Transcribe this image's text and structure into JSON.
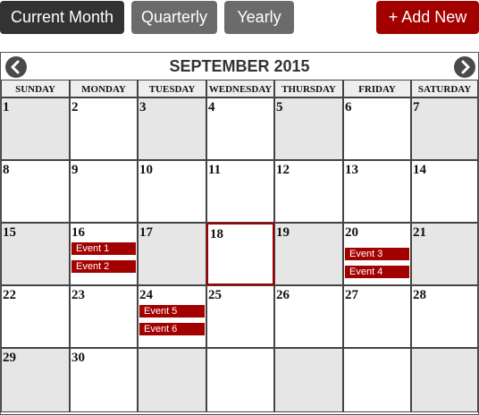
{
  "toolbar": {
    "current_month_label": "Current Month",
    "quarterly_label": "Quarterly",
    "yearly_label": "Yearly",
    "add_new_label": "+ Add New"
  },
  "calendar": {
    "title": "SEPTEMBER 2015",
    "weekdays": [
      "SUNDAY",
      "MONDAY",
      "TUESDAY",
      "WEDNESDAY",
      "THURSDAY",
      "FRIDAY",
      "SATURDAY"
    ],
    "weeks": [
      [
        {
          "day": "1",
          "shaded": true,
          "events": []
        },
        {
          "day": "2",
          "shaded": false,
          "events": []
        },
        {
          "day": "3",
          "shaded": true,
          "events": []
        },
        {
          "day": "4",
          "shaded": false,
          "events": []
        },
        {
          "day": "5",
          "shaded": true,
          "events": []
        },
        {
          "day": "6",
          "shaded": false,
          "events": []
        },
        {
          "day": "7",
          "shaded": true,
          "events": []
        }
      ],
      [
        {
          "day": "8",
          "shaded": false,
          "events": []
        },
        {
          "day": "9",
          "shaded": false,
          "events": []
        },
        {
          "day": "10",
          "shaded": false,
          "events": []
        },
        {
          "day": "11",
          "shaded": false,
          "events": []
        },
        {
          "day": "12",
          "shaded": false,
          "events": []
        },
        {
          "day": "13",
          "shaded": false,
          "events": []
        },
        {
          "day": "14",
          "shaded": false,
          "events": []
        }
      ],
      [
        {
          "day": "15",
          "shaded": true,
          "events": []
        },
        {
          "day": "16",
          "shaded": false,
          "events": [
            "Event 1",
            "Event 2"
          ]
        },
        {
          "day": "17",
          "shaded": true,
          "events": []
        },
        {
          "day": "18",
          "shaded": false,
          "today": true,
          "events": []
        },
        {
          "day": "19",
          "shaded": true,
          "events": []
        },
        {
          "day": "20",
          "shaded": false,
          "events": [
            "Event 3",
            "Event 4"
          ]
        },
        {
          "day": "21",
          "shaded": true,
          "events": []
        }
      ],
      [
        {
          "day": "22",
          "shaded": false,
          "events": []
        },
        {
          "day": "23",
          "shaded": false,
          "events": []
        },
        {
          "day": "24",
          "shaded": false,
          "events": [
            "Event 5",
            "Event 6"
          ]
        },
        {
          "day": "25",
          "shaded": false,
          "events": []
        },
        {
          "day": "26",
          "shaded": false,
          "events": []
        },
        {
          "day": "27",
          "shaded": false,
          "events": []
        },
        {
          "day": "28",
          "shaded": false,
          "events": []
        }
      ],
      [
        {
          "day": "29",
          "shaded": true,
          "events": []
        },
        {
          "day": "30",
          "shaded": false,
          "events": []
        },
        {
          "day": "",
          "shaded": true,
          "events": []
        },
        {
          "day": "",
          "shaded": false,
          "events": []
        },
        {
          "day": "",
          "shaded": true,
          "events": []
        },
        {
          "day": "",
          "shaded": false,
          "events": []
        },
        {
          "day": "",
          "shaded": true,
          "events": []
        }
      ]
    ]
  },
  "colors": {
    "accent": "#a30000",
    "dark_button": "#333333",
    "grey_button": "#6b6b6b",
    "shaded_cell": "#e6e6e6"
  },
  "icons": {
    "prev": "chevron-left-icon",
    "next": "chevron-right-icon"
  }
}
